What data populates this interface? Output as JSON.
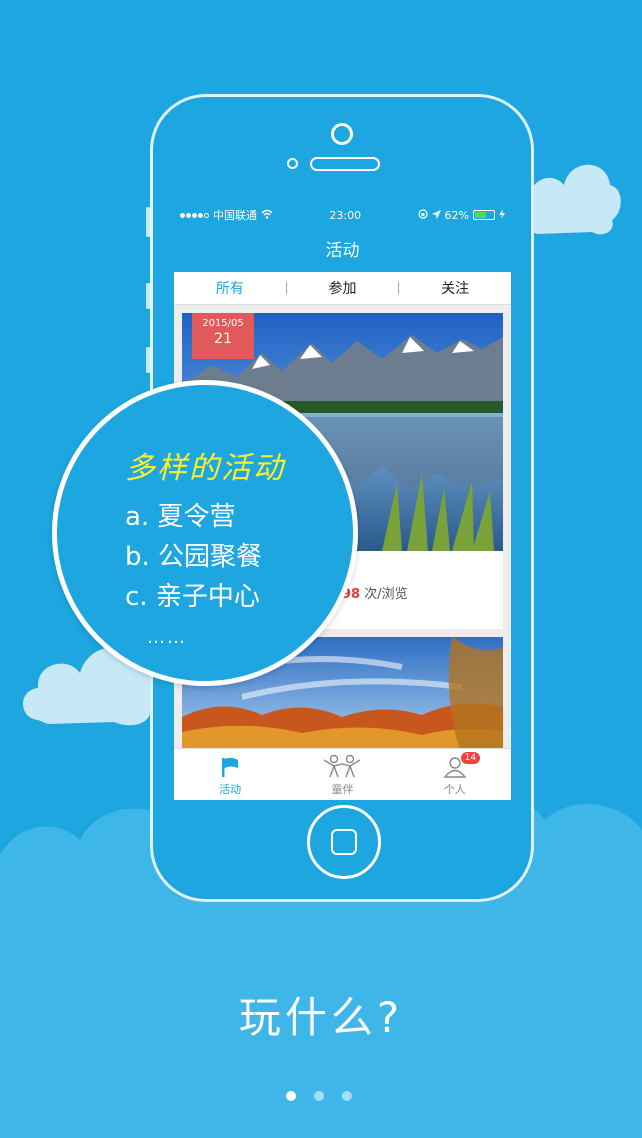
{
  "status_bar": {
    "carrier": "中国联通",
    "time": "23:00",
    "battery": "62%"
  },
  "nav": {
    "title": "活动"
  },
  "tabs": [
    {
      "label": "所有"
    },
    {
      "label": "参加"
    },
    {
      "label": "关注"
    }
  ],
  "cards": [
    {
      "date_month": "2015/05",
      "date_day": "21",
      "views_num": "98",
      "views_label": "次/浏览"
    }
  ],
  "bottom_tabs": [
    {
      "label": "活动",
      "icon": "flag-icon"
    },
    {
      "label": "童伴",
      "icon": "friends-icon"
    },
    {
      "label": "个人",
      "icon": "person-icon",
      "badge": "14"
    }
  ],
  "feature": {
    "title": "多样的活动",
    "items": [
      "a. 夏令营",
      "b. 公园聚餐",
      "c. 亲子中心"
    ],
    "more": "……"
  },
  "slogan": "玩什么?",
  "pager": {
    "count": 3,
    "active": 0
  },
  "colors": {
    "background": "#1da6e0",
    "accent": "#1da6e0",
    "highlight": "#ffef2a",
    "ribbon": "#e05a5a"
  }
}
